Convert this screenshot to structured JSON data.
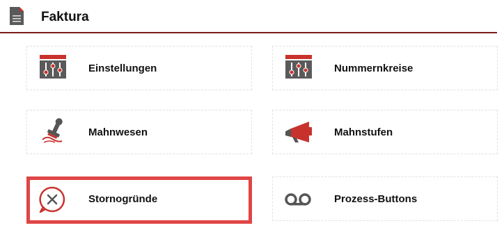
{
  "header": {
    "title": "Faktura",
    "icon": "document-icon"
  },
  "tiles": [
    {
      "label": "Einstellungen",
      "icon": "settings-sliders-icon"
    },
    {
      "label": "Nummernkreise",
      "icon": "settings-sliders-icon"
    },
    {
      "label": "Mahnwesen",
      "icon": "stamp-icon"
    },
    {
      "label": "Mahnstufen",
      "icon": "megaphone-icon"
    },
    {
      "label": "Stornogründe",
      "icon": "cancel-bubble-icon",
      "highlighted": true
    },
    {
      "label": "Prozess-Buttons",
      "icon": "voicemail-icon"
    }
  ],
  "colors": {
    "accent": "#c8322d",
    "highlight_border": "#e04545",
    "header_rule": "#7a1a1a",
    "icon_gray": "#555555"
  }
}
